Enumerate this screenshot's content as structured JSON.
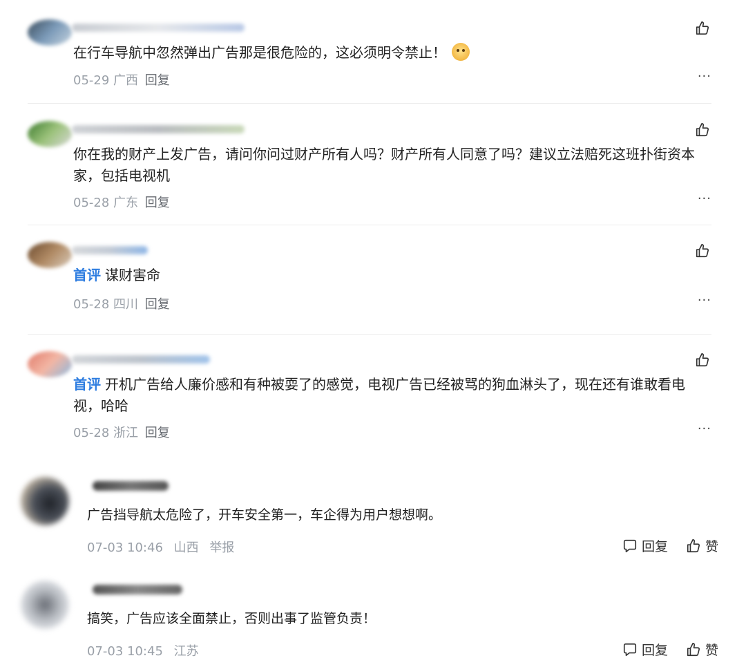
{
  "comments_top": [
    {
      "text": "在行车导航中忽然弹出广告那是很危险的，这必须明令禁止！",
      "badge": "",
      "date": "05-29",
      "location": "广西",
      "reply_label": "回复",
      "more_label": "···",
      "emoji_icon": "doge-emoji-icon"
    },
    {
      "text": "你在我的财产上发广告，请问你问过财产所有人吗？财产所有人同意了吗？建议立法赔死这班扑街资本家，包括电视机",
      "badge": "",
      "date": "05-28",
      "location": "广东",
      "reply_label": "回复",
      "more_label": "···"
    },
    {
      "text": "谋财害命",
      "badge": "首评",
      "date": "05-28",
      "location": "四川",
      "reply_label": "回复",
      "more_label": "···"
    },
    {
      "text": "开机广告给人廉价感和有种被耍了的感觉，电视广告已经被骂的狗血淋头了，现在还有谁敢看电视，哈哈",
      "badge": "首评",
      "date": "05-28",
      "location": "浙江",
      "reply_label": "回复",
      "more_label": "···"
    }
  ],
  "comments_bottom": [
    {
      "text": "广告挡导航太危险了，开车安全第一，车企得为用户想想啊。",
      "datetime": "07-03 10:46",
      "location": "山西",
      "report_label": "举报",
      "reply_label": "回复",
      "like_label": "赞"
    },
    {
      "text": "搞笑，广告应该全面禁止，否则出事了监管负责！",
      "datetime": "07-03 10:45",
      "location": "江苏",
      "reply_label": "回复",
      "like_label": "赞"
    }
  ],
  "colors": {
    "badge": "#2e7de0",
    "meta": "#9aa0a8",
    "text": "#222222"
  },
  "icons": {
    "like": "thumbs-up-icon",
    "reply": "comment-bubble-icon",
    "more": "more-dots-icon"
  }
}
